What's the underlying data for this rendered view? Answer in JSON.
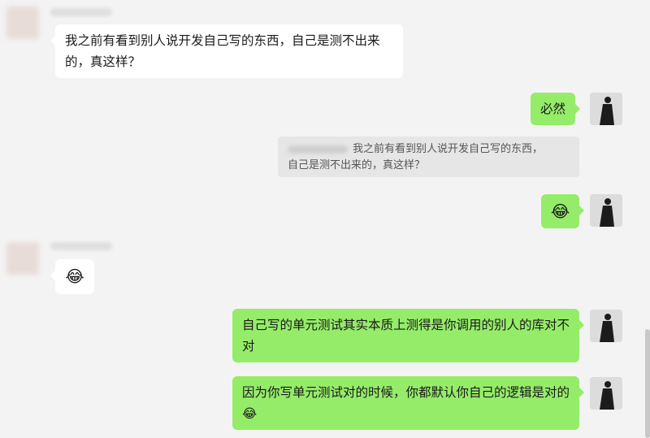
{
  "messages": {
    "m1": {
      "sender": "peer",
      "text": "我之前有看到别人说开发自己写的东西，自己是测不出来的，真这样？"
    },
    "m2": {
      "sender": "self",
      "text": "必然"
    },
    "quote": {
      "line1": "我之前有看到别人说开发自己写的东西，",
      "line2": "自己是测不出来的，真这样？"
    },
    "m3": {
      "sender": "self",
      "emoji": "😂"
    },
    "m4": {
      "sender": "peer",
      "emoji": "😂"
    },
    "m5": {
      "sender": "self",
      "text": "自己写的单元测试其实本质上测得是你调用的别人的库对不对"
    },
    "m6": {
      "sender": "self",
      "text": "因为你写单元测试对的时候，你都默认你自己的逻辑是对的",
      "emoji": "😂"
    }
  }
}
